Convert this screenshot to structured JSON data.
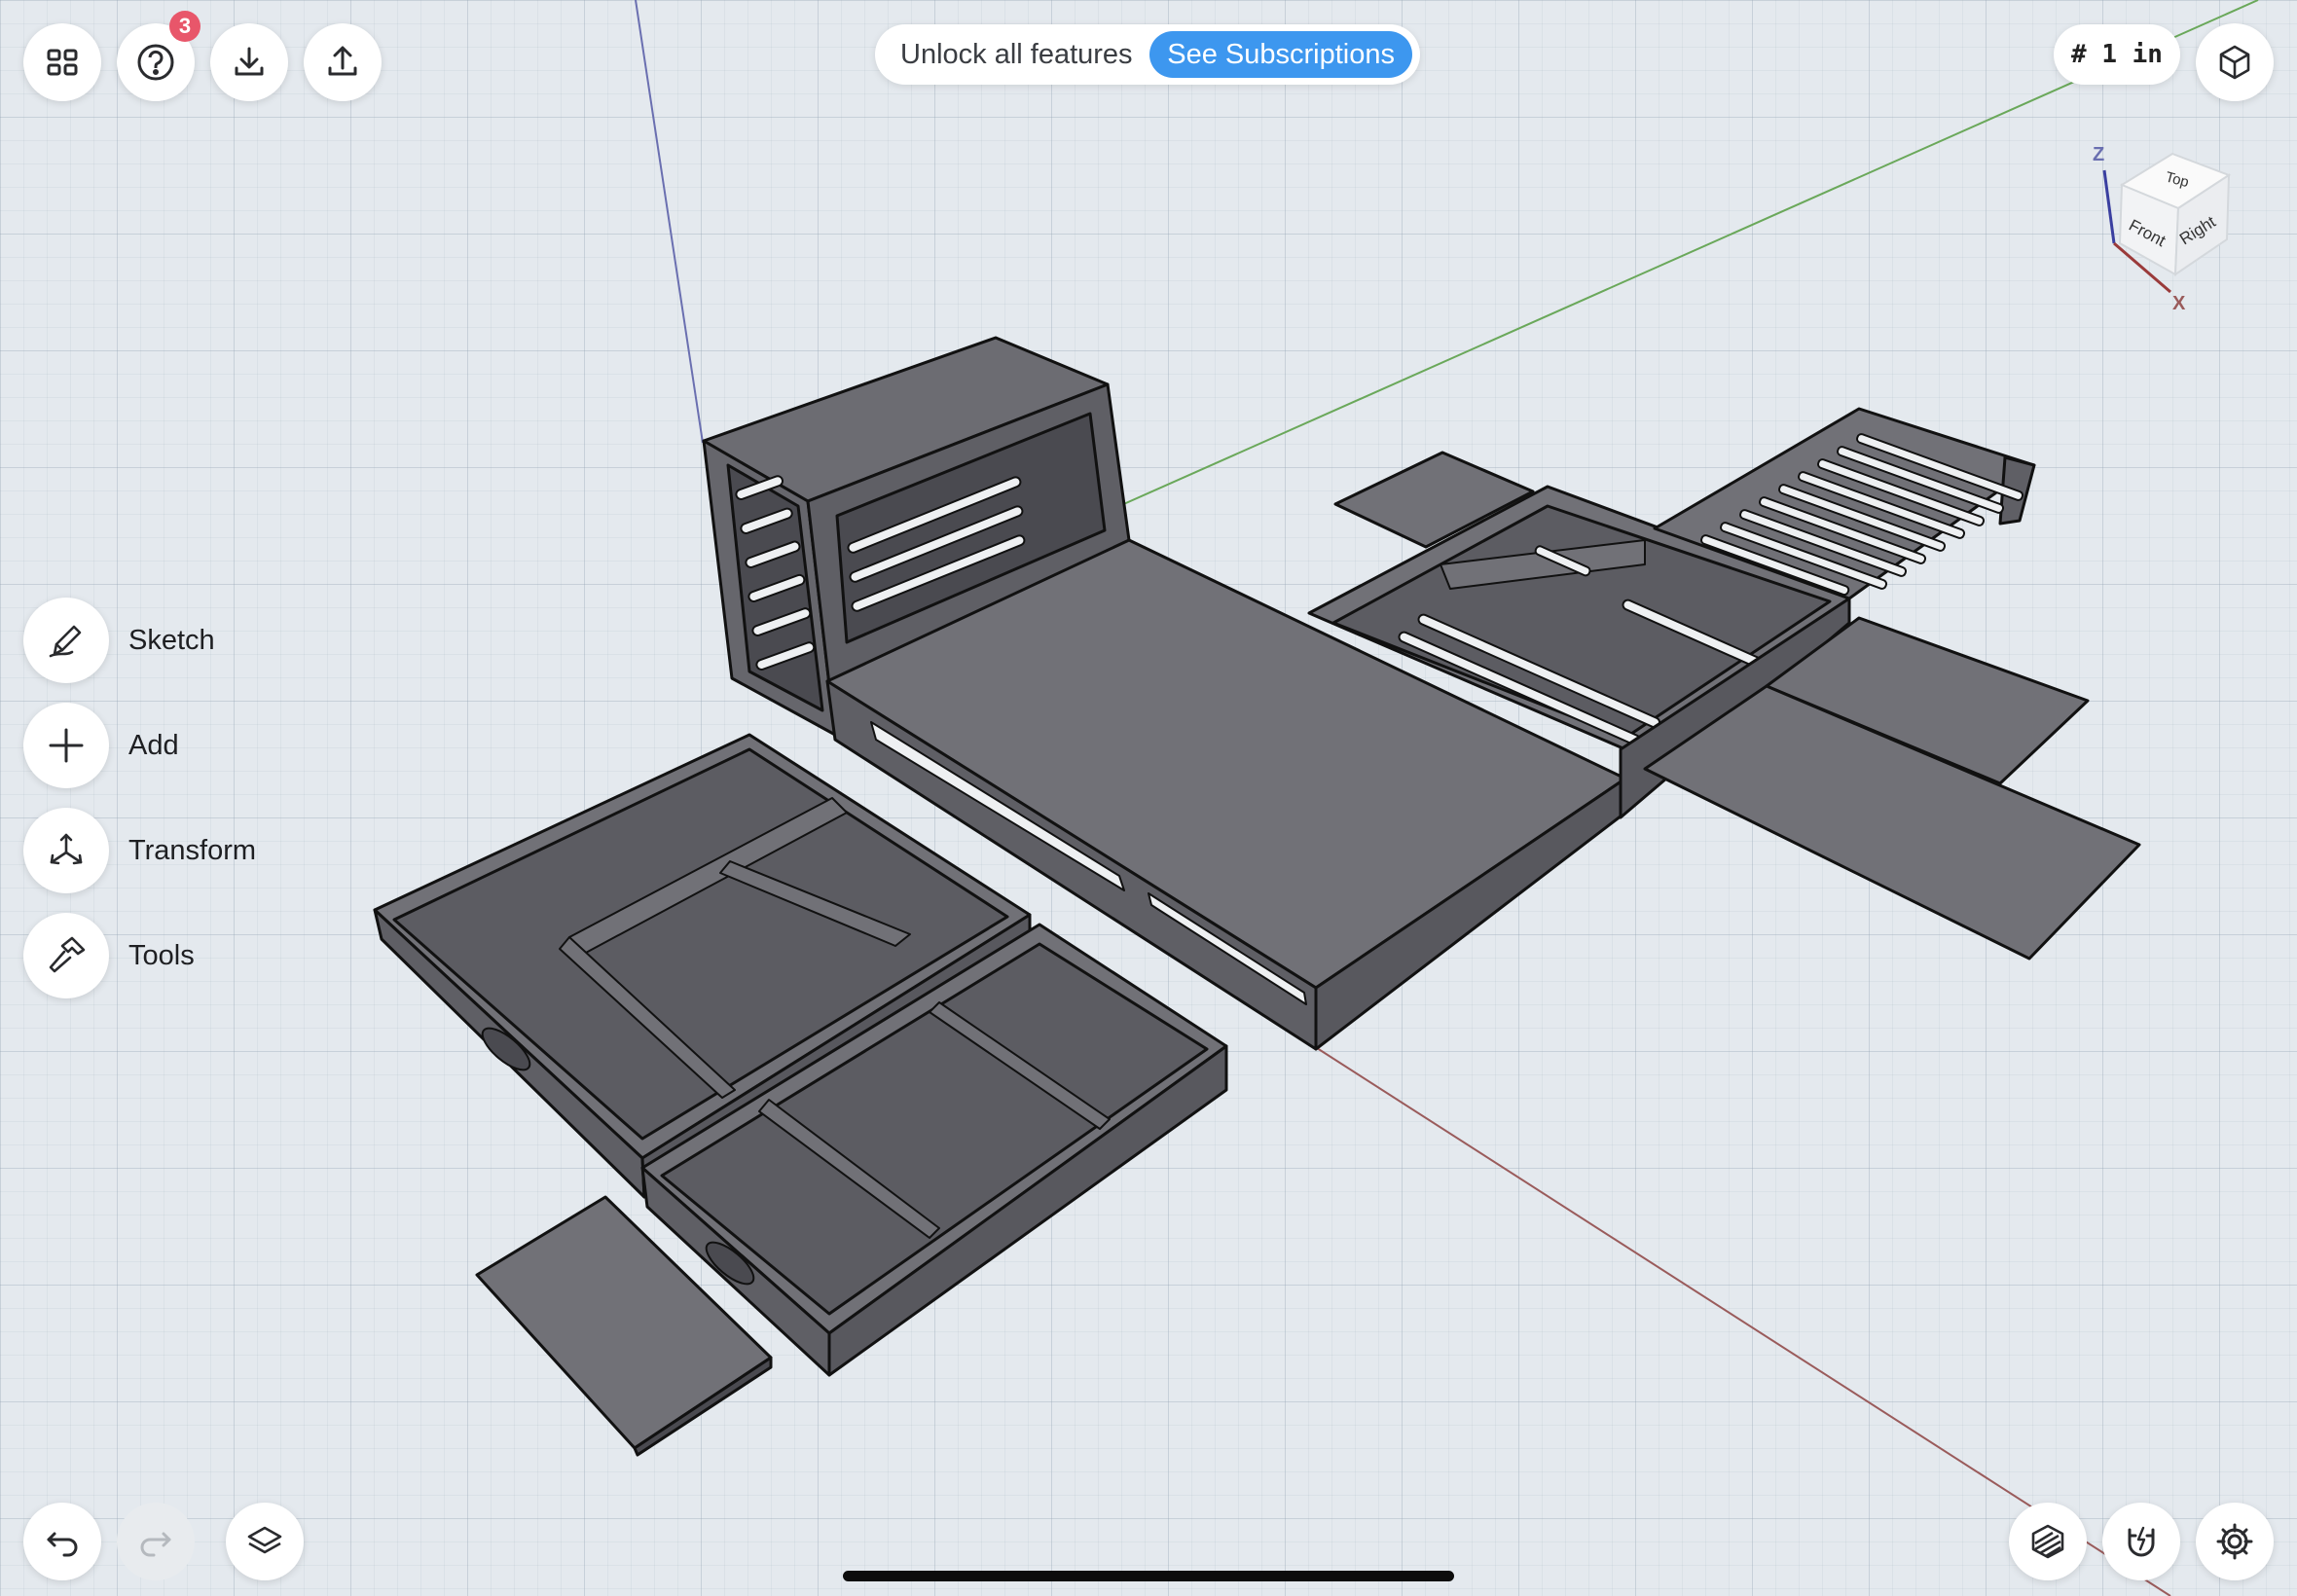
{
  "toolbar": {
    "grid_icon": "grid-icon",
    "help_icon": "help-icon",
    "help_badge": "3",
    "import_icon": "import-icon",
    "export_icon": "export-icon"
  },
  "promo": {
    "text": "Unlock all features",
    "button_label": "See Subscriptions",
    "button_color": "#3d97ef"
  },
  "units": {
    "label": "# 1 in"
  },
  "view_cube": {
    "face_top": "Top",
    "face_front": "Front",
    "face_right": "Right",
    "axis_z": "Z",
    "axis_x": "X"
  },
  "tools": [
    {
      "label": "Sketch",
      "icon": "pencil-icon"
    },
    {
      "label": "Add",
      "icon": "plus-icon"
    },
    {
      "label": "Transform",
      "icon": "transform-icon"
    },
    {
      "label": "Tools",
      "icon": "hammer-icon"
    }
  ],
  "bottom": {
    "undo_icon": "undo-icon",
    "redo_icon": "redo-icon",
    "layers_icon": "layers-icon",
    "render_icon": "render-style-icon",
    "snap_icon": "magnet-icon",
    "settings_icon": "gear-icon"
  },
  "colors": {
    "model_fill": "#717177",
    "axis_x": "#9a5b5b",
    "axis_y": "#6aa85a",
    "axis_z": "#6a6fb0",
    "badge": "#e8566a"
  }
}
